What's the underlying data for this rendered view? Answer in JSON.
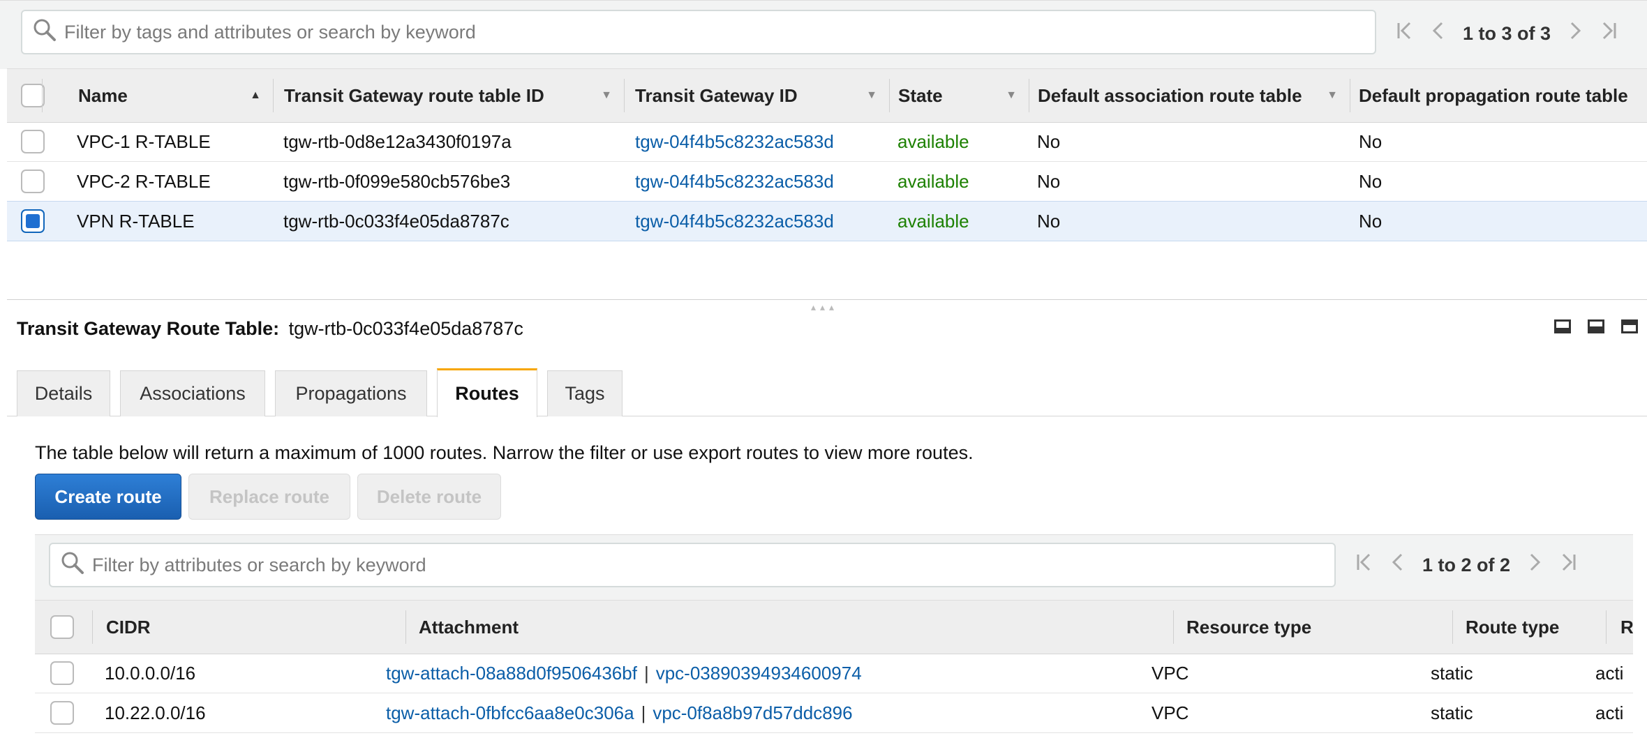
{
  "top": {
    "search_placeholder": "Filter by tags and attributes or search by keyword",
    "pager_text": "1 to 3 of 3",
    "columns": [
      "Name",
      "Transit Gateway route table ID",
      "Transit Gateway ID",
      "State",
      "Default association route table",
      "Default propagation route table"
    ],
    "rows": [
      {
        "name": "VPC-1 R-TABLE",
        "rtb_id": "tgw-rtb-0d8e12a3430f0197a",
        "tgw_id": "tgw-04f4b5c8232ac583d",
        "state": "available",
        "default_assoc": "No",
        "default_prop": "No",
        "selected": false
      },
      {
        "name": "VPC-2 R-TABLE",
        "rtb_id": "tgw-rtb-0f099e580cb576be3",
        "tgw_id": "tgw-04f4b5c8232ac583d",
        "state": "available",
        "default_assoc": "No",
        "default_prop": "No",
        "selected": false
      },
      {
        "name": "VPN R-TABLE",
        "rtb_id": "tgw-rtb-0c033f4e05da8787c",
        "tgw_id": "tgw-04f4b5c8232ac583d",
        "state": "available",
        "default_assoc": "No",
        "default_prop": "No",
        "selected": true
      }
    ]
  },
  "detail": {
    "title_label": "Transit Gateway Route Table:",
    "title_value": "tgw-rtb-0c033f4e05da8787c",
    "tabs": [
      "Details",
      "Associations",
      "Propagations",
      "Routes",
      "Tags"
    ],
    "active_tab": "Routes",
    "info_text": "The table below will return a maximum of 1000 routes. Narrow the filter or use export routes to view more routes.",
    "buttons": {
      "create": "Create route",
      "replace": "Replace route",
      "delete": "Delete route"
    },
    "routes": {
      "search_placeholder": "Filter by attributes or search by keyword",
      "pager_text": "1 to 2 of 2",
      "columns": [
        "CIDR",
        "Attachment",
        "Resource type",
        "Route type",
        "Rou"
      ],
      "rows": [
        {
          "cidr": "10.0.0.0/16",
          "attachment": "tgw-attach-08a88d0f9506436bf",
          "vpc": "vpc-03890394934600974",
          "resource_type": "VPC",
          "route_type": "static",
          "route_state": "acti"
        },
        {
          "cidr": "10.22.0.0/16",
          "attachment": "tgw-attach-0fbfcc6aa8e0c306a",
          "vpc": "vpc-0f8a8b97d57ddc896",
          "resource_type": "VPC",
          "route_type": "static",
          "route_state": "acti"
        }
      ],
      "separator": "|"
    }
  },
  "colors": {
    "link": "#0b5ea8",
    "available": "#1d8102",
    "active_tab": "#f7a600",
    "primary_button": "#1f6fd1"
  }
}
